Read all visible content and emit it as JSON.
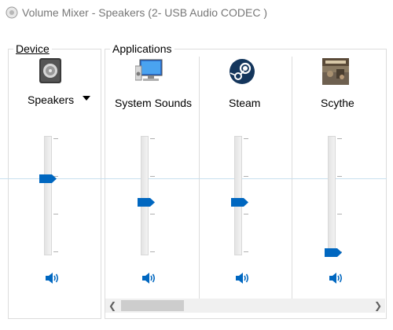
{
  "window": {
    "title": "Volume Mixer - Speakers (2- USB Audio CODEC )"
  },
  "device": {
    "group_label": "Device",
    "name": "Speakers",
    "volume_percent": 68,
    "icon": "speaker-device-icon"
  },
  "applications": {
    "group_label": "Applications",
    "items": [
      {
        "label": "System Sounds",
        "volume_percent": 46,
        "icon": "system-sounds-icon"
      },
      {
        "label": "Steam",
        "volume_percent": 46,
        "icon": "steam-icon"
      },
      {
        "label": "Scythe",
        "volume_percent": 2,
        "icon": "scythe-game-icon"
      }
    ]
  },
  "colors": {
    "accent": "#0067c0",
    "border": "#dcdcdc",
    "peak_line": "#c8e0ee"
  }
}
